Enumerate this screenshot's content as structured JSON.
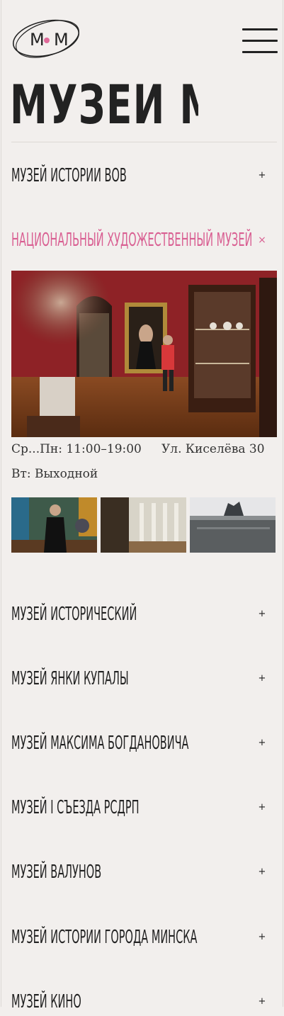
{
  "brand": {
    "logo_text": "M M",
    "title": "МУЗЕИ МИНСКА"
  },
  "colors": {
    "background": "#f2efed",
    "text": "#222222",
    "accent": "#d95f92"
  },
  "menu": {
    "icon": "hamburger-menu-icon"
  },
  "museums": [
    {
      "name": "МУЗЕЙ ИСТОРИИ ВОВ",
      "open": false,
      "sign": "+"
    },
    {
      "name": "НАЦИОНАЛЬНЫЙ ХУДОЖЕСТВЕННЫЙ МУЗЕЙ",
      "open": true,
      "sign": "×"
    },
    {
      "name": "МУЗЕЙ ИСТОРИЧЕСКИЙ",
      "open": false,
      "sign": "+"
    },
    {
      "name": "МУЗЕЙ ЯНКИ КУПАЛЫ",
      "open": false,
      "sign": "+"
    },
    {
      "name": "МУЗЕЙ МАКСИМА БОГДАНОВИЧА",
      "open": false,
      "sign": "+"
    },
    {
      "name": "МУЗЕЙ I СЪЕЗДА РСДРП",
      "open": false,
      "sign": "+"
    },
    {
      "name": "МУЗЕЙ ВАЛУНОВ",
      "open": false,
      "sign": "+"
    },
    {
      "name": "МУЗЕЙ ИСТОРИИ ГОРОДА МИНСКА",
      "open": false,
      "sign": "+"
    },
    {
      "name": "МУЗЕЙ КИНО",
      "open": false,
      "sign": "+"
    }
  ],
  "details": {
    "hours": "Ср...Пн: 11:00–19:00",
    "address": "Ул. Киселёва 30",
    "day_off": "Вт: Выходной"
  }
}
